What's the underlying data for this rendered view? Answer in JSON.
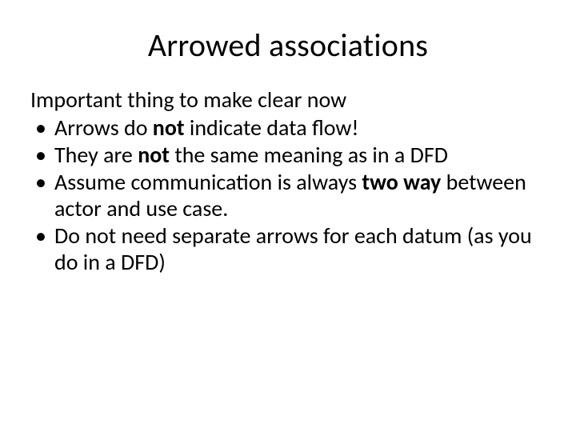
{
  "title": "Arrowed associations",
  "intro": "Important thing to make clear now",
  "bullets": {
    "b1": {
      "pre": "Arrows do ",
      "bold": "not",
      "post": " indicate data flow!"
    },
    "b2": {
      "pre": "They are ",
      "bold": "not",
      "post": " the same meaning as in a DFD"
    },
    "b3": {
      "pre": "Assume communication is always ",
      "bold": "two way",
      "post": " between actor and use case."
    },
    "b4": {
      "text": "Do not need separate arrows for each datum (as you do in a DFD)"
    }
  }
}
